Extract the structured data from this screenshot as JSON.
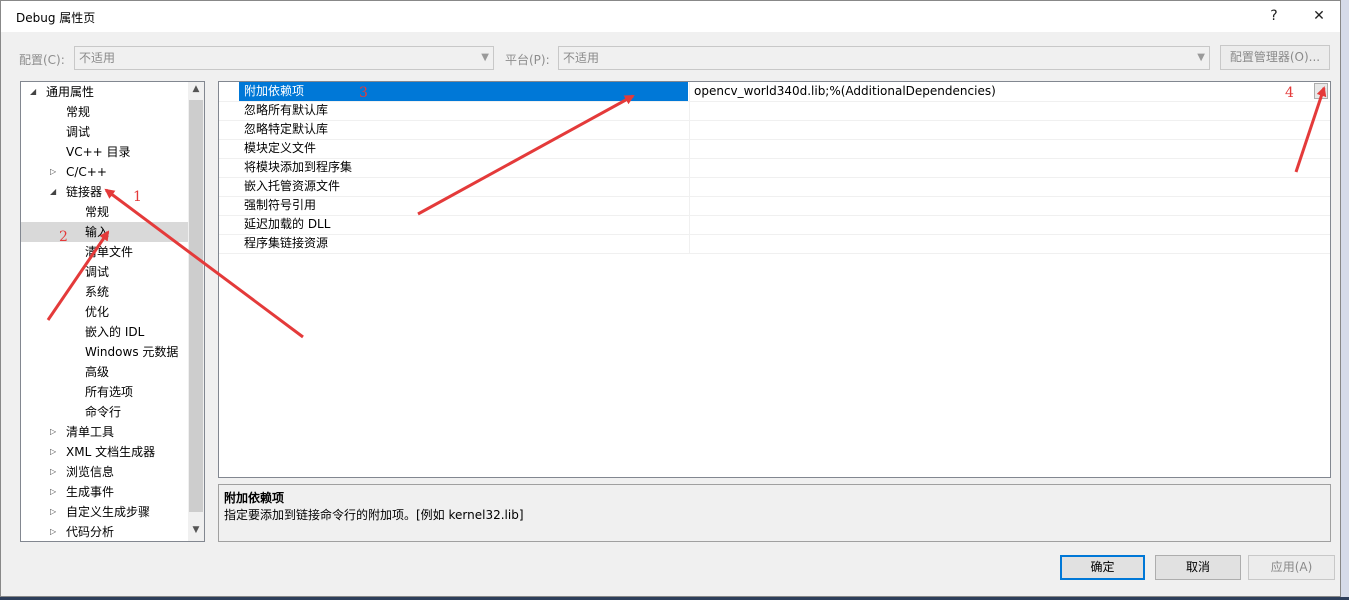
{
  "window": {
    "title": "Debug 属性页",
    "help_label": "?",
    "close_label": "✕"
  },
  "config": {
    "config_label": "配置(C):",
    "config_value": "不适用",
    "platform_label": "平台(P):",
    "platform_value": "不适用",
    "manager_label": "配置管理器(O)..."
  },
  "tree": {
    "items": [
      {
        "label": "通用属性",
        "expander": "◢"
      },
      {
        "label": "常规"
      },
      {
        "label": "调试"
      },
      {
        "label": "VC++ 目录"
      },
      {
        "label": "C/C++",
        "expander": "▷"
      },
      {
        "label": "链接器",
        "expander": "◢"
      },
      {
        "label": "常规"
      },
      {
        "label": "输入",
        "selected": true
      },
      {
        "label": "清单文件"
      },
      {
        "label": "调试"
      },
      {
        "label": "系统"
      },
      {
        "label": "优化"
      },
      {
        "label": "嵌入的 IDL"
      },
      {
        "label": "Windows 元数据"
      },
      {
        "label": "高级"
      },
      {
        "label": "所有选项"
      },
      {
        "label": "命令行"
      },
      {
        "label": "清单工具",
        "expander": "▷"
      },
      {
        "label": "XML 文档生成器",
        "expander": "▷"
      },
      {
        "label": "浏览信息",
        "expander": "▷"
      },
      {
        "label": "生成事件",
        "expander": "▷"
      },
      {
        "label": "自定义生成步骤",
        "expander": "▷"
      },
      {
        "label": "代码分析",
        "expander": "▷"
      }
    ]
  },
  "properties": {
    "rows": [
      {
        "name": "附加依赖项",
        "value": "opencv_world340d.lib;%(AdditionalDependencies)",
        "selected": true
      },
      {
        "name": "忽略所有默认库",
        "value": ""
      },
      {
        "name": "忽略特定默认库",
        "value": ""
      },
      {
        "name": "模块定义文件",
        "value": ""
      },
      {
        "name": "将模块添加到程序集",
        "value": ""
      },
      {
        "name": "嵌入托管资源文件",
        "value": ""
      },
      {
        "name": "强制符号引用",
        "value": ""
      },
      {
        "name": "延迟加载的 DLL",
        "value": ""
      },
      {
        "name": "程序集链接资源",
        "value": ""
      }
    ]
  },
  "description": {
    "title": "附加依赖项",
    "text": "指定要添加到链接命令行的附加项。[例如 kernel32.lib]"
  },
  "buttons": {
    "ok": "确定",
    "cancel": "取消",
    "apply": "应用(A)"
  },
  "annotations": {
    "n1": "1",
    "n2": "2",
    "n3": "3",
    "n4": "4"
  },
  "colors": {
    "selection": "#0078d7",
    "annotation": "#e43a3a"
  }
}
